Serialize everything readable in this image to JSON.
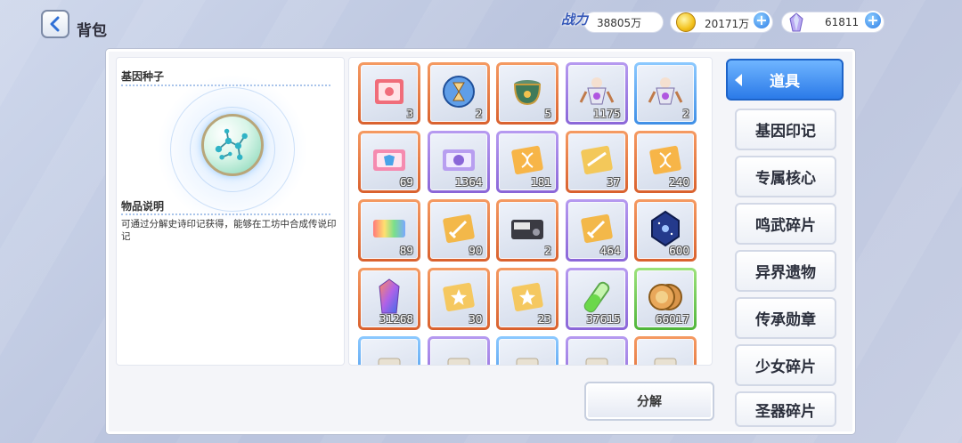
{
  "header": {
    "title": "背包",
    "power_label": "战力",
    "power_value": "38805万",
    "coins_value": "20171万",
    "gems_value": "61811"
  },
  "detail": {
    "item_name": "基因种子",
    "desc_title": "物品说明",
    "desc_text": "可通过分解史诗印记获得，能够在工坊中合成传说印记"
  },
  "grid": {
    "items": [
      {
        "count": "3",
        "rarity": "orange",
        "icon": "ticket-icon"
      },
      {
        "count": "2",
        "rarity": "orange",
        "icon": "hourglass-orb-icon"
      },
      {
        "count": "5",
        "rarity": "orange",
        "icon": "treasure-pot-icon"
      },
      {
        "count": "1175",
        "rarity": "purple",
        "icon": "mecha-figure-icon"
      },
      {
        "count": "2",
        "rarity": "blue",
        "icon": "mecha-figure-icon"
      },
      {
        "count": "69",
        "rarity": "orange",
        "icon": "outfit-ticket-icon"
      },
      {
        "count": "1364",
        "rarity": "purple",
        "icon": "smile-ticket-icon"
      },
      {
        "count": "181",
        "rarity": "purple",
        "icon": "gene-card-icon"
      },
      {
        "count": "37",
        "rarity": "orange",
        "icon": "gold-card-icon"
      },
      {
        "count": "240",
        "rarity": "orange",
        "icon": "gene-card-icon"
      },
      {
        "count": "89",
        "rarity": "orange",
        "icon": "rainbow-ticket-icon"
      },
      {
        "count": "90",
        "rarity": "orange",
        "icon": "sword-card-icon"
      },
      {
        "count": "2",
        "rarity": "orange",
        "icon": "device-icon"
      },
      {
        "count": "464",
        "rarity": "purple",
        "icon": "sword-card-icon"
      },
      {
        "count": "600",
        "rarity": "orange",
        "icon": "dark-crystal-icon"
      },
      {
        "count": "31268",
        "rarity": "orange",
        "icon": "rainbow-crystal-icon"
      },
      {
        "count": "30",
        "rarity": "orange",
        "icon": "star-card-icon"
      },
      {
        "count": "23",
        "rarity": "orange",
        "icon": "star-card-icon"
      },
      {
        "count": "37615",
        "rarity": "purple",
        "icon": "potion-tube-icon"
      },
      {
        "count": "66017",
        "rarity": "green",
        "icon": "cookie-coin-icon"
      },
      {
        "count": "",
        "rarity": "blue",
        "icon": "item-icon"
      },
      {
        "count": "",
        "rarity": "purple",
        "icon": "item-icon"
      },
      {
        "count": "",
        "rarity": "blue",
        "icon": "item-icon"
      },
      {
        "count": "",
        "rarity": "purple",
        "icon": "item-icon"
      },
      {
        "count": "",
        "rarity": "orange",
        "icon": "item-icon"
      }
    ]
  },
  "actions": {
    "decompose_label": "分解"
  },
  "tabs": [
    {
      "label": "道具",
      "active": true
    },
    {
      "label": "基因印记",
      "active": false
    },
    {
      "label": "专属核心",
      "active": false
    },
    {
      "label": "鸣武碎片",
      "active": false
    },
    {
      "label": "异界遗物",
      "active": false
    },
    {
      "label": "传承勋章",
      "active": false
    },
    {
      "label": "少女碎片",
      "active": false
    },
    {
      "label": "圣器碎片",
      "active": false
    }
  ],
  "colors": {
    "orange": "#e37a45",
    "purple": "#9d7ee4",
    "blue": "#5aa6f0",
    "green": "#6dc855",
    "accent": "#2b7ae8"
  }
}
